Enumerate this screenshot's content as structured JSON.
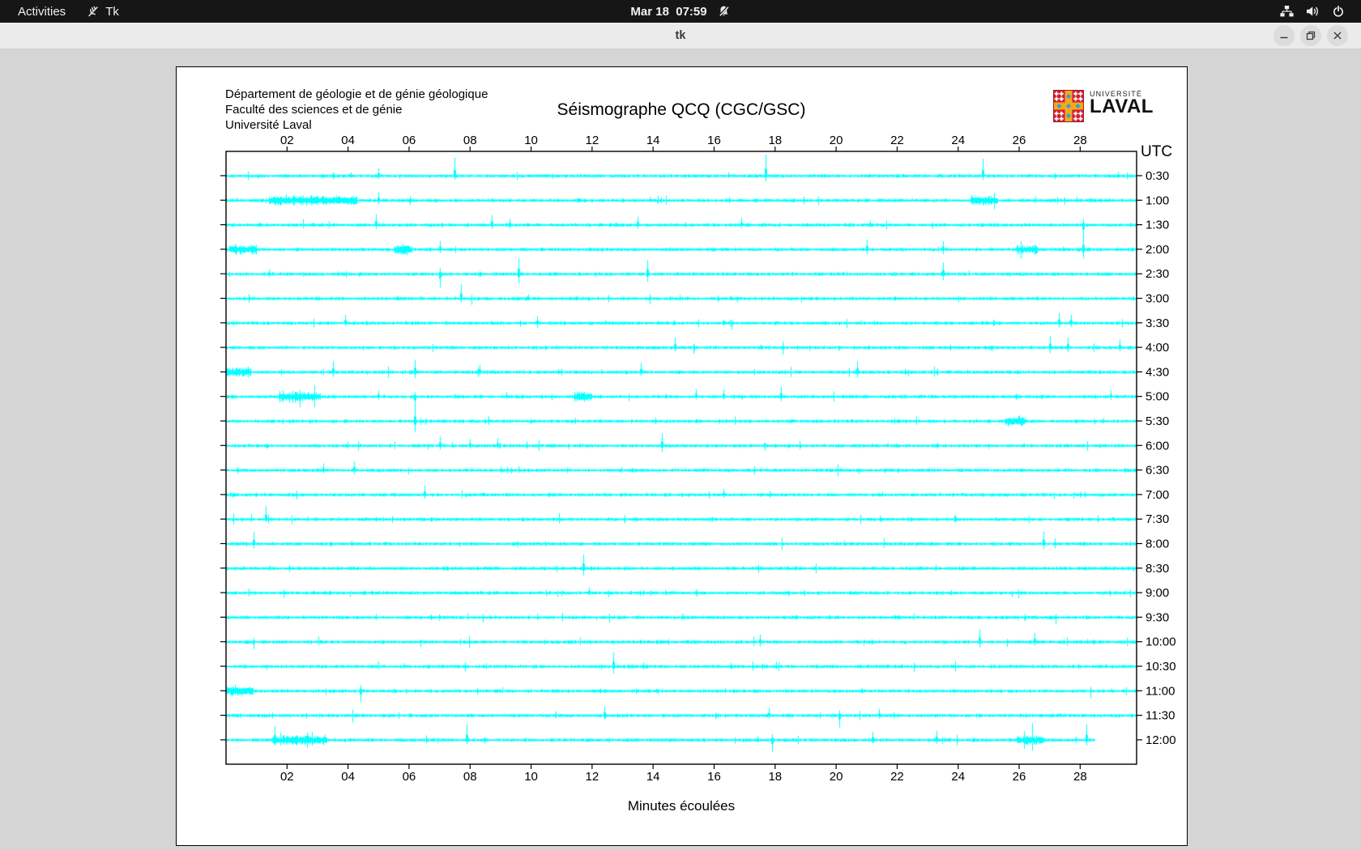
{
  "topbar": {
    "activities": "Activities",
    "app_name": "Tk",
    "clock": "Mar 18  07:59",
    "icons": [
      "tk-icon",
      "notifications-muted-icon",
      "network-icon",
      "volume-icon",
      "power-icon"
    ]
  },
  "titlebar": {
    "title": "tk",
    "controls": [
      "minimize",
      "maximize",
      "close"
    ]
  },
  "header": {
    "line1": "Département de géologie et de génie géologique",
    "line2": "Faculté des sciences et de génie",
    "line3": "Université Laval"
  },
  "logo": {
    "line1": "UNIVERSITÉ",
    "line2": "LAVAL"
  },
  "chart_data": {
    "type": "line",
    "title": "Séismographe QCQ (CGC/GSC)",
    "xlabel": "Minutes écoulées",
    "right_axis_label": "UTC",
    "x_ticks": [
      "02",
      "04",
      "06",
      "08",
      "10",
      "12",
      "14",
      "16",
      "18",
      "20",
      "22",
      "24",
      "26",
      "28"
    ],
    "x_range_minutes": [
      0,
      29.85
    ],
    "grid": false,
    "trace_color": "#00ffff",
    "axis_color": "#000000",
    "utc_label_color": "#ff2222",
    "rows": [
      {
        "label": "0:30",
        "spikes": [
          [
            4.1,
            4,
            3
          ],
          [
            5.0,
            9,
            4
          ],
          [
            7.5,
            22,
            5
          ],
          [
            17.7,
            26,
            7
          ],
          [
            24.8,
            21,
            5
          ]
        ],
        "bursts": []
      },
      {
        "label": "1:00",
        "spikes": [
          [
            5.0,
            10,
            5
          ],
          [
            13.9,
            4,
            3
          ],
          [
            16.5,
            4,
            4
          ]
        ],
        "bursts": [
          [
            1.4,
            4.3
          ],
          [
            24.4,
            25.3
          ]
        ]
      },
      {
        "label": "1:30",
        "spikes": [
          [
            4.9,
            13,
            5
          ],
          [
            8.7,
            12,
            5
          ],
          [
            9.3,
            7,
            4
          ],
          [
            13.5,
            10,
            5
          ],
          [
            16.9,
            8,
            4
          ],
          [
            21.1,
            5,
            3
          ],
          [
            28.1,
            7,
            18
          ]
        ],
        "bursts": []
      },
      {
        "label": "2:00",
        "spikes": [
          [
            7.0,
            10,
            5
          ],
          [
            21.0,
            12,
            6
          ],
          [
            23.5,
            10,
            5
          ],
          [
            28.1,
            17,
            11
          ]
        ],
        "bursts": [
          [
            0.1,
            1.0
          ],
          [
            5.5,
            6.1
          ],
          [
            25.9,
            26.6
          ]
        ]
      },
      {
        "label": "2:30",
        "spikes": [
          [
            1.4,
            5,
            4
          ],
          [
            7.0,
            7,
            17
          ],
          [
            9.6,
            19,
            12
          ],
          [
            13.8,
            17,
            10
          ],
          [
            23.5,
            14,
            8
          ]
        ],
        "bursts": []
      },
      {
        "label": "3:00",
        "spikes": [
          [
            7.7,
            18,
            5
          ],
          [
            9.9,
            5,
            3
          ]
        ],
        "bursts": []
      },
      {
        "label": "3:30",
        "spikes": [
          [
            3.9,
            10,
            4
          ],
          [
            10.2,
            8,
            4
          ],
          [
            27.3,
            12,
            6
          ],
          [
            27.7,
            10,
            5
          ]
        ],
        "bursts": []
      },
      {
        "label": "4:00",
        "spikes": [
          [
            14.7,
            12,
            5
          ],
          [
            27.0,
            14,
            7
          ],
          [
            27.6,
            12,
            6
          ],
          [
            29.3,
            10,
            5
          ]
        ],
        "bursts": []
      },
      {
        "label": "4:30",
        "spikes": [
          [
            3.5,
            13,
            6
          ],
          [
            6.2,
            15,
            8
          ],
          [
            8.3,
            9,
            4
          ],
          [
            13.6,
            11,
            5
          ],
          [
            20.7,
            13,
            7
          ]
        ],
        "bursts": [
          [
            0.0,
            0.8
          ]
        ]
      },
      {
        "label": "5:00",
        "spikes": [
          [
            5.0,
            7,
            4
          ],
          [
            6.2,
            5,
            15
          ],
          [
            9.2,
            5,
            3
          ],
          [
            15.4,
            9,
            4
          ],
          [
            16.3,
            9,
            4
          ],
          [
            18.2,
            12,
            6
          ],
          [
            29.0,
            7,
            4
          ]
        ],
        "bursts": [
          [
            1.7,
            3.1
          ],
          [
            11.4,
            12.0
          ]
        ]
      },
      {
        "label": "5:30",
        "spikes": [
          [
            6.2,
            17,
            14
          ]
        ],
        "bursts": [
          [
            25.5,
            26.2
          ]
        ]
      },
      {
        "label": "6:00",
        "spikes": [
          [
            7.0,
            11,
            5
          ],
          [
            8.0,
            8,
            4
          ],
          [
            8.9,
            9,
            4
          ],
          [
            14.3,
            15,
            8
          ]
        ],
        "bursts": []
      },
      {
        "label": "6:30",
        "spikes": [
          [
            3.2,
            8,
            4
          ],
          [
            4.2,
            11,
            5
          ],
          [
            9.0,
            4,
            3
          ]
        ],
        "bursts": []
      },
      {
        "label": "7:00",
        "spikes": [
          [
            6.5,
            11,
            5
          ],
          [
            16.3,
            7,
            4
          ]
        ],
        "bursts": []
      },
      {
        "label": "7:30",
        "spikes": [
          [
            1.3,
            16,
            4
          ]
        ],
        "bursts": []
      },
      {
        "label": "8:00",
        "spikes": [
          [
            0.9,
            14,
            6
          ],
          [
            26.8,
            15,
            7
          ]
        ],
        "bursts": []
      },
      {
        "label": "8:30",
        "spikes": [
          [
            11.7,
            17,
            9
          ]
        ],
        "bursts": []
      },
      {
        "label": "9:00",
        "spikes": [
          [
            11.9,
            6,
            3
          ]
        ],
        "bursts": []
      },
      {
        "label": "9:30",
        "spikes": [],
        "bursts": []
      },
      {
        "label": "10:00",
        "spikes": [
          [
            17.5,
            9,
            6
          ],
          [
            24.7,
            15,
            7
          ],
          [
            26.5,
            11,
            5
          ]
        ],
        "bursts": []
      },
      {
        "label": "10:30",
        "spikes": [
          [
            12.7,
            17,
            9
          ]
        ],
        "bursts": []
      },
      {
        "label": "11:00",
        "spikes": [
          [
            4.4,
            7,
            14
          ]
        ],
        "bursts": [
          [
            0.0,
            0.9
          ]
        ]
      },
      {
        "label": "11:30",
        "spikes": [
          [
            12.4,
            11,
            5
          ],
          [
            17.8,
            9,
            4
          ],
          [
            20.1,
            6,
            15
          ],
          [
            21.4,
            8,
            4
          ]
        ],
        "bursts": []
      },
      {
        "label": "12:00",
        "spikes": [
          [
            1.6,
            17,
            7
          ],
          [
            7.9,
            19,
            5
          ],
          [
            17.9,
            7,
            15
          ],
          [
            21.2,
            10,
            4
          ],
          [
            23.3,
            11,
            5
          ],
          [
            28.2,
            19,
            7
          ]
        ],
        "bursts": [
          [
            1.5,
            3.3
          ],
          [
            25.9,
            26.8
          ]
        ],
        "end": 28.5
      }
    ]
  }
}
